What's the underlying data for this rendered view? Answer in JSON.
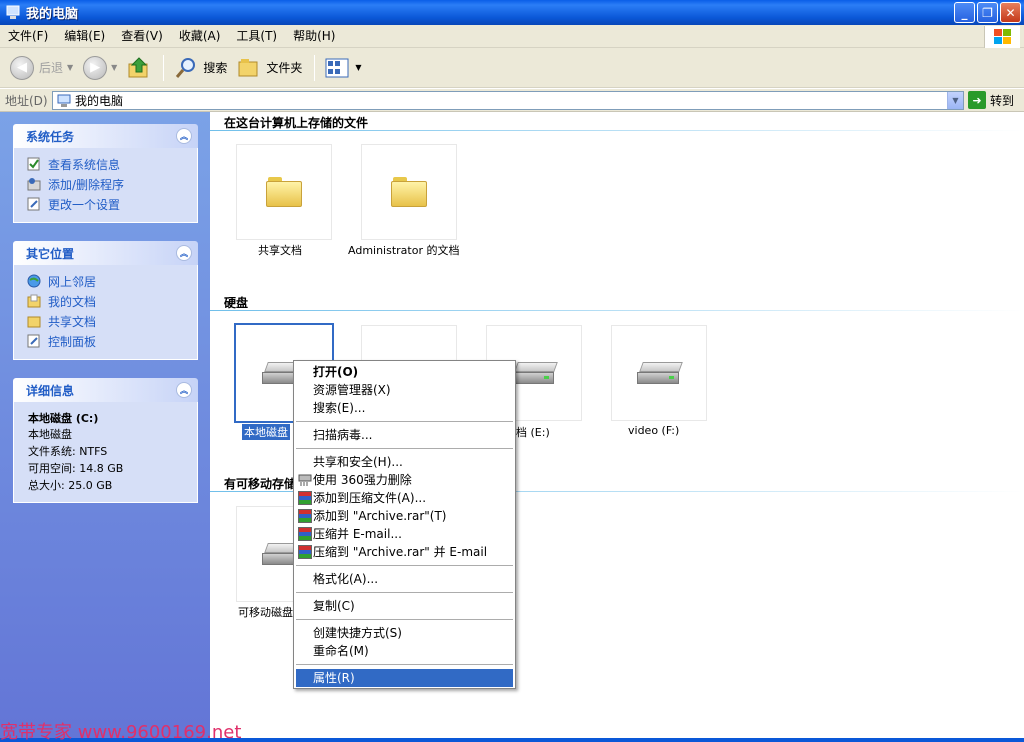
{
  "window": {
    "title": "我的电脑"
  },
  "menu": [
    "文件(F)",
    "编辑(E)",
    "查看(V)",
    "收藏(A)",
    "工具(T)",
    "帮助(H)"
  ],
  "toolbar": {
    "back_label": "后退",
    "search_label": "搜索",
    "folders_label": "文件夹"
  },
  "address": {
    "label": "地址(D)",
    "value": "我的电脑",
    "go_label": "转到"
  },
  "sidebar": {
    "system_tasks": {
      "title": "系统任务",
      "items": [
        "查看系统信息",
        "添加/删除程序",
        "更改一个设置"
      ]
    },
    "other_places": {
      "title": "其它位置",
      "items": [
        "网上邻居",
        "我的文档",
        "共享文档",
        "控制面板"
      ]
    },
    "details": {
      "title": "详细信息",
      "name": "本地磁盘 (C:)",
      "type": "本地磁盘",
      "fs": "文件系统: NTFS",
      "free": "可用空间: 14.8 GB",
      "total": "总大小: 25.0 GB"
    }
  },
  "content": {
    "stored_files_title": "在这台计算机上存储的文件",
    "folders": [
      "共享文档",
      "Administrator 的文档"
    ],
    "hard_disks_title": "硬盘",
    "drives": [
      "本地磁盘",
      "档 (E:)",
      "video (F:)"
    ],
    "removable_title": "有可移动存储",
    "removable": [
      "可移动磁盘"
    ]
  },
  "context_menu": [
    "打开(O)",
    "资源管理器(X)",
    "搜索(E)...",
    "扫描病毒...",
    "共享和安全(H)...",
    "使用 360强力删除",
    "添加到压缩文件(A)...",
    "添加到 \"Archive.rar\"(T)",
    "压缩并 E-mail...",
    "压缩到 \"Archive.rar\" 并 E-mail",
    "格式化(A)...",
    "复制(C)",
    "创建快捷方式(S)",
    "重命名(M)",
    "属性(R)"
  ],
  "watermark": "宽带专家 www.9600169.net"
}
